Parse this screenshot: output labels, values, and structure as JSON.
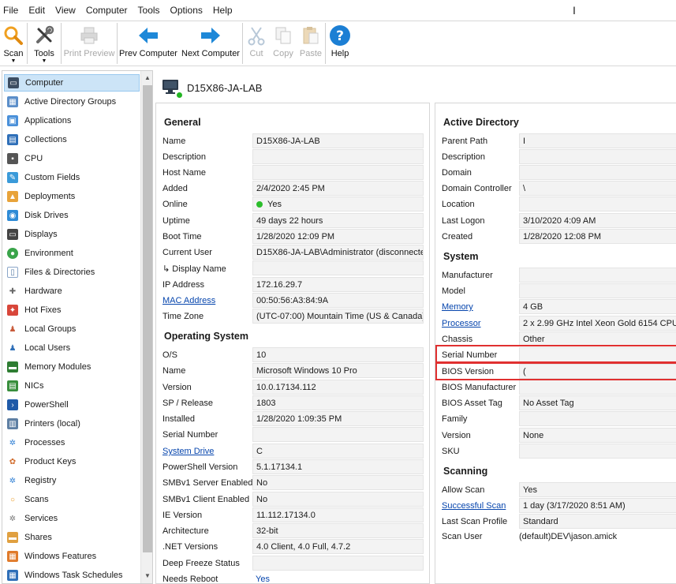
{
  "menu": [
    "File",
    "Edit",
    "View",
    "Computer",
    "Tools",
    "Options",
    "Help"
  ],
  "toolbar": {
    "scan": "Scan",
    "tools": "Tools",
    "print_preview": "Print Preview",
    "prev_computer": "Prev Computer",
    "next_computer": "Next Computer",
    "cut": "Cut",
    "copy": "Copy",
    "paste": "Paste",
    "help": "Help"
  },
  "sidebar": {
    "items": [
      {
        "label": "Computer",
        "icon": "computer-icon",
        "active": true
      },
      {
        "label": "Active Directory Groups",
        "icon": "ad-groups-icon"
      },
      {
        "label": "Applications",
        "icon": "applications-icon"
      },
      {
        "label": "Collections",
        "icon": "collections-icon"
      },
      {
        "label": "CPU",
        "icon": "cpu-icon"
      },
      {
        "label": "Custom Fields",
        "icon": "custom-fields-icon"
      },
      {
        "label": "Deployments",
        "icon": "deployments-icon"
      },
      {
        "label": "Disk Drives",
        "icon": "disk-drives-icon"
      },
      {
        "label": "Displays",
        "icon": "displays-icon"
      },
      {
        "label": "Environment",
        "icon": "environment-icon"
      },
      {
        "label": "Files & Directories",
        "icon": "files-icon"
      },
      {
        "label": "Hardware",
        "icon": "hardware-icon"
      },
      {
        "label": "Hot Fixes",
        "icon": "hot-fixes-icon"
      },
      {
        "label": "Local Groups",
        "icon": "local-groups-icon"
      },
      {
        "label": "Local Users",
        "icon": "local-users-icon"
      },
      {
        "label": "Memory Modules",
        "icon": "memory-icon"
      },
      {
        "label": "NICs",
        "icon": "nics-icon"
      },
      {
        "label": "PowerShell",
        "icon": "powershell-icon"
      },
      {
        "label": "Printers (local)",
        "icon": "printers-icon"
      },
      {
        "label": "Processes",
        "icon": "processes-icon"
      },
      {
        "label": "Product Keys",
        "icon": "product-keys-icon"
      },
      {
        "label": "Registry",
        "icon": "registry-icon"
      },
      {
        "label": "Scans",
        "icon": "scans-icon"
      },
      {
        "label": "Services",
        "icon": "services-icon"
      },
      {
        "label": "Shares",
        "icon": "shares-icon"
      },
      {
        "label": "Windows Features",
        "icon": "windows-features-icon"
      },
      {
        "label": "Windows Task Schedules",
        "icon": "task-schedules-icon"
      }
    ]
  },
  "computer": {
    "name": "D15X86-JA-LAB"
  },
  "general": {
    "title": "General",
    "rows": [
      {
        "label": "Name",
        "value": "D15X86-JA-LAB"
      },
      {
        "label": "Description",
        "value": ""
      },
      {
        "label": "Host Name",
        "value": ""
      },
      {
        "label": "Added",
        "value": "2/4/2020 2:45 PM"
      },
      {
        "label": "Online",
        "value": "Yes"
      },
      {
        "label": "Uptime",
        "value": "49 days 22 hours"
      },
      {
        "label": "Boot Time",
        "value": "1/28/2020 12:09 PM"
      },
      {
        "label": "Current User",
        "value": "D15X86-JA-LAB\\Administrator (disconnecte"
      },
      {
        "label": "↳ Display Name",
        "value": ""
      },
      {
        "label": "IP Address",
        "value": "172.16.29.7"
      },
      {
        "label": "MAC Address",
        "value": "00:50:56:A3:84:9A",
        "link": true
      },
      {
        "label": "Time Zone",
        "value": "(UTC-07:00) Mountain Time (US & Canada)"
      }
    ]
  },
  "os": {
    "title": "Operating System",
    "rows": [
      {
        "label": "O/S",
        "value": "10"
      },
      {
        "label": "Name",
        "value": "Microsoft Windows 10 Pro"
      },
      {
        "label": "Version",
        "value": "10.0.17134.112"
      },
      {
        "label": "SP / Release",
        "value": "1803"
      },
      {
        "label": "Installed",
        "value": "1/28/2020 1:09:35 PM"
      },
      {
        "label": "Serial Number",
        "value": ""
      },
      {
        "label": "System Drive",
        "value": "C",
        "link": true
      },
      {
        "label": "PowerShell Version",
        "value": "5.1.17134.1"
      },
      {
        "label": "SMBv1 Server Enabled",
        "value": "No"
      },
      {
        "label": "SMBv1 Client Enabled",
        "value": "No"
      },
      {
        "label": "IE Version",
        "value": "11.112.17134.0"
      },
      {
        "label": "Architecture",
        "value": "32-bit"
      },
      {
        "label": ".NET Versions",
        "value": "4.0 Client, 4.0 Full, 4.7.2"
      },
      {
        "label": "Deep Freeze Status",
        "value": ""
      },
      {
        "label": "Needs Reboot",
        "value": "Yes"
      }
    ]
  },
  "ad": {
    "title": "Active Directory",
    "rows": [
      {
        "label": "Parent Path",
        "value": "I"
      },
      {
        "label": "Description",
        "value": ""
      },
      {
        "label": "Domain",
        "value": ""
      },
      {
        "label": "Domain Controller",
        "value": "\\"
      },
      {
        "label": "Location",
        "value": ""
      },
      {
        "label": "Last Logon",
        "value": "3/10/2020 4:09 AM"
      },
      {
        "label": "Created",
        "value": "1/28/2020 12:08 PM"
      }
    ]
  },
  "system": {
    "title": "System",
    "rows": [
      {
        "label": "Manufacturer",
        "value": ""
      },
      {
        "label": "Model",
        "value": ""
      },
      {
        "label": "Memory",
        "value": "4 GB",
        "link": true
      },
      {
        "label": "Processor",
        "value": "2 x 2.99 GHz Intel Xeon Gold 6154 CPU @",
        "link": true
      },
      {
        "label": "Chassis",
        "value": "Other"
      },
      {
        "label": "Serial Number",
        "value": ""
      },
      {
        "label": "BIOS Version",
        "value": "("
      },
      {
        "label": "BIOS Manufacturer",
        "value": ""
      },
      {
        "label": "BIOS Asset Tag",
        "value": "No Asset Tag"
      },
      {
        "label": "Family",
        "value": ""
      },
      {
        "label": "Version",
        "value": "None"
      },
      {
        "label": "SKU",
        "value": ""
      }
    ]
  },
  "scanning": {
    "title": "Scanning",
    "rows": [
      {
        "label": "Allow Scan",
        "value": "Yes"
      },
      {
        "label": "Successful Scan",
        "value": "1 day (3/17/2020 8:51 AM)",
        "link": true
      },
      {
        "label": "Last Scan Profile",
        "value": "Standard"
      },
      {
        "label": "Scan User",
        "value": "(default)DEV\\jason.amick"
      }
    ]
  }
}
